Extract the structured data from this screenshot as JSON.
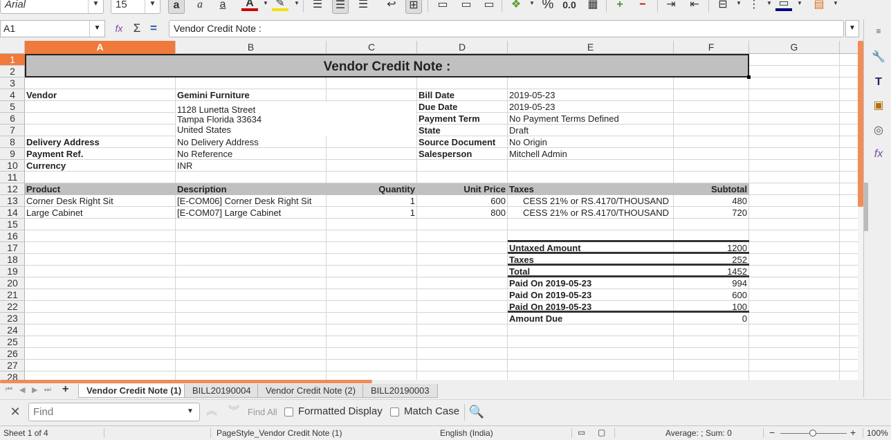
{
  "toolbar": {
    "font_name": "Arial",
    "font_size": "15",
    "percent_label": "%",
    "decimal_label": "0.0"
  },
  "formula_bar": {
    "cell_ref": "A1",
    "content": "Vendor Credit Note :"
  },
  "columns": [
    {
      "label": "A",
      "active": true
    },
    {
      "label": "B",
      "active": false
    },
    {
      "label": "C",
      "active": false
    },
    {
      "label": "D",
      "active": false
    },
    {
      "label": "E",
      "active": false
    },
    {
      "label": "F",
      "active": false
    },
    {
      "label": "G",
      "active": false
    }
  ],
  "rows": [
    "1",
    "2",
    "3",
    "4",
    "5",
    "6",
    "7",
    "8",
    "9",
    "10",
    "11",
    "12",
    "13",
    "14",
    "15",
    "16",
    "17",
    "18",
    "19",
    "20",
    "21",
    "22",
    "23",
    "24",
    "25",
    "26",
    "27",
    "28"
  ],
  "sheet": {
    "title": "Vendor Credit Note :",
    "vendor_label": "Vendor",
    "vendor_name": "Gemini Furniture",
    "address_line1": "1128 Lunetta Street",
    "address_line2": "Tampa Florida 33634",
    "address_line3": "United States",
    "delivery_label": "Delivery Address",
    "delivery_value": "No Delivery Address",
    "payref_label": "Payment Ref.",
    "payref_value": "No Reference",
    "currency_label": "Currency",
    "currency_value": "INR",
    "bill_date_label": "Bill Date",
    "bill_date_value": "2019-05-23",
    "due_date_label": "Due Date",
    "due_date_value": "2019-05-23",
    "payment_term_label": "Payment Term",
    "payment_term_value": "No Payment Terms Defined",
    "state_label": "State",
    "state_value": "Draft",
    "source_label": "Source Document",
    "source_value": "No Origin",
    "salesperson_label": "Salesperson",
    "salesperson_value": "Mitchell Admin",
    "table_headers": {
      "product": "Product",
      "description": "Description",
      "quantity": "Quantity",
      "unit_price": "Unit Price",
      "taxes": "Taxes",
      "subtotal": "Subtotal"
    },
    "lines": [
      {
        "product": "Corner Desk Right Sit",
        "description": "[E-COM06] Corner Desk Right Sit",
        "quantity": "1",
        "unit_price": "600",
        "taxes": "CESS 21% or RS.4170/THOUSAND",
        "subtotal": "480"
      },
      {
        "product": "Large Cabinet",
        "description": "[E-COM07] Large Cabinet",
        "quantity": "1",
        "unit_price": "800",
        "taxes": "CESS 21% or RS.4170/THOUSAND",
        "subtotal": "720"
      }
    ],
    "totals": [
      {
        "label": "Untaxed Amount",
        "value": "1200"
      },
      {
        "label": "Taxes",
        "value": "252"
      },
      {
        "label": "Total",
        "value": "1452"
      },
      {
        "label": "Paid On 2019-05-23",
        "value": "994"
      },
      {
        "label": "Paid On 2019-05-23",
        "value": "600"
      },
      {
        "label": "Paid On 2019-05-23",
        "value": "100"
      },
      {
        "label": "Amount Due",
        "value": "0"
      }
    ]
  },
  "tabs": [
    {
      "label": "Vendor Credit Note (1)",
      "active": true
    },
    {
      "label": "BILL20190004",
      "active": false
    },
    {
      "label": "Vendor Credit Note (2)",
      "active": false
    },
    {
      "label": "BILL20190003",
      "active": false
    }
  ],
  "find_bar": {
    "placeholder": "Find",
    "find_all": "Find All",
    "formatted_display": "Formatted Display",
    "match_case": "Match Case"
  },
  "status_bar": {
    "sheet_pos": "Sheet 1 of 4",
    "page_style": "PageStyle_Vendor Credit Note (1)",
    "language": "English (India)",
    "summary": "Average: ; Sum: 0",
    "zoom": "100%"
  },
  "colors": {
    "accent": "#ef7a3c",
    "header_shade": "#c0c0c0"
  }
}
